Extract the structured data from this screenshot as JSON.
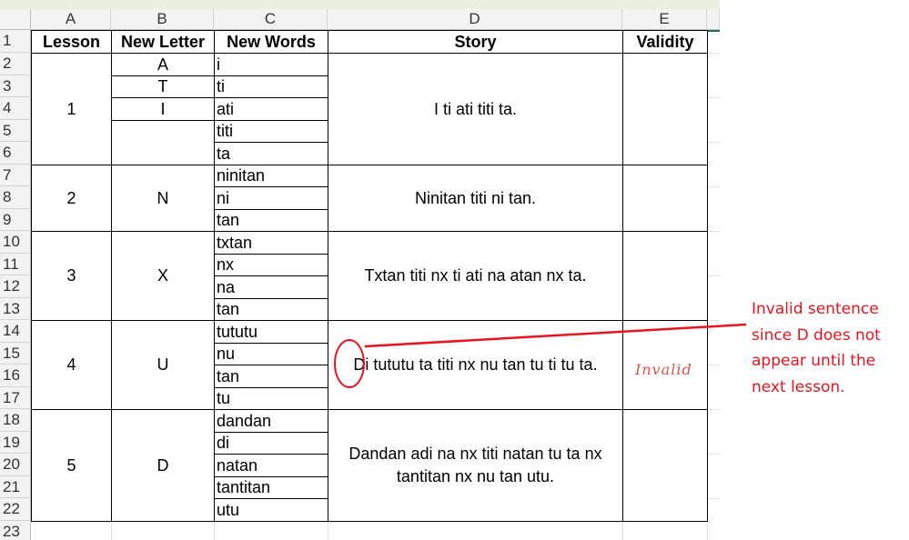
{
  "columns": [
    "A",
    "B",
    "C",
    "D",
    "E"
  ],
  "rows": [
    "1",
    "2",
    "3",
    "4",
    "5",
    "6",
    "7",
    "8",
    "9",
    "10",
    "11",
    "12",
    "13",
    "14",
    "15",
    "16",
    "17",
    "18",
    "19",
    "20",
    "21",
    "22",
    "23"
  ],
  "headers": {
    "lesson": "Lesson",
    "new_letter": "New Letter",
    "new_words": "New Words",
    "story": "Story",
    "validity": "Validity"
  },
  "lessons": [
    {
      "lesson": "1",
      "letters": [
        "A",
        "T",
        "I",
        ""
      ],
      "words": [
        "i",
        "ti",
        "ati",
        "titi",
        "ta"
      ],
      "story": "I ti ati titi ta.",
      "validity": ""
    },
    {
      "lesson": "2",
      "letter": "N",
      "words": [
        "ninitan",
        "ni",
        "tan"
      ],
      "story": "Ninitan titi ni tan.",
      "validity": ""
    },
    {
      "lesson": "3",
      "letter": "X",
      "words": [
        "txtan",
        "nx",
        "na",
        "tan"
      ],
      "story": "Txtan titi nx ti ati na atan nx ta.",
      "validity": ""
    },
    {
      "lesson": "4",
      "letter": "U",
      "words": [
        "tututu",
        "nu",
        "tan",
        "tu"
      ],
      "story": "Di tututu ta titi nx nu tan tu ti tu ta.",
      "validity": "Invalid"
    },
    {
      "lesson": "5",
      "letter": "D",
      "words": [
        "dandan",
        "di",
        "natan",
        "tantitan",
        "utu"
      ],
      "story": "Dandan adi na nx titi natan tu ta nx tantitan nx nu tan utu.",
      "validity": ""
    }
  ],
  "annotation": {
    "lines": [
      "Invalid sentence",
      "since D does not",
      "appear until the",
      "next lesson."
    ],
    "color": "#e8141f"
  },
  "colors": {
    "header_strip": "#e9efe1",
    "annotation_red": "#e8141f",
    "invalid_text": "#d9534f"
  }
}
